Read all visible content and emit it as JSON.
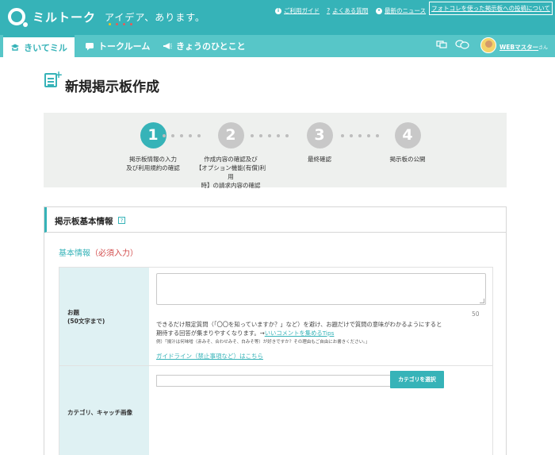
{
  "header": {
    "logo_text": "ミルトーク",
    "tagline": "アイデア、あります。",
    "links": {
      "guide": "ご利用ガイド",
      "faq": "よくある質問",
      "news": "最新のニュース"
    },
    "promo": "フォトコレを使った掲示板への投稿について"
  },
  "nav": {
    "tabs": [
      "きいてミル",
      "トークルーム",
      "きょうのひとこと"
    ],
    "user_name": "WEBマスター",
    "user_suffix": "さん"
  },
  "page": {
    "title": "新規掲示板作成"
  },
  "steps": [
    {
      "number": "1",
      "label_lines": [
        "掲示板情報の入力",
        "及び利用規約の確認"
      ],
      "active": true
    },
    {
      "number": "2",
      "label_lines": [
        "作成内容の確認及び",
        "【オプション機能(有償)利用",
        "時】の請求内容の確認"
      ],
      "active": false
    },
    {
      "number": "3",
      "label_lines": [
        "最終確認"
      ],
      "active": false
    },
    {
      "number": "4",
      "label_lines": [
        "掲示板の公開"
      ],
      "active": false
    }
  ],
  "section": {
    "title": "掲示板基本情報",
    "help": "?",
    "basic_label": "基本情報",
    "basic_required": "（必須入力）"
  },
  "form": {
    "topic_label": "お題",
    "topic_sublabel": "(50文字まで)",
    "topic_value": "",
    "counter": "50",
    "hint_line1": "できるだけ限定質問（「〇〇を知っていますか？」など）を避け、お題だけで質問の意味がわかるようにすると",
    "hint_line2_prefix": "期待する回答が集まりやすくなります。→",
    "hint_link": "いいコメントを集めるTips",
    "example": "例）「揚汁は何味噌（赤みそ、合わせみそ、白みそ等）が好きですか？その理由もご自由にお書きください。」",
    "guideline": "ガイドライン（禁止事項など）はこちら",
    "category_label": "カテゴリ、キャッチ画像",
    "category_value": "",
    "category_button": "カテゴリを選択"
  }
}
